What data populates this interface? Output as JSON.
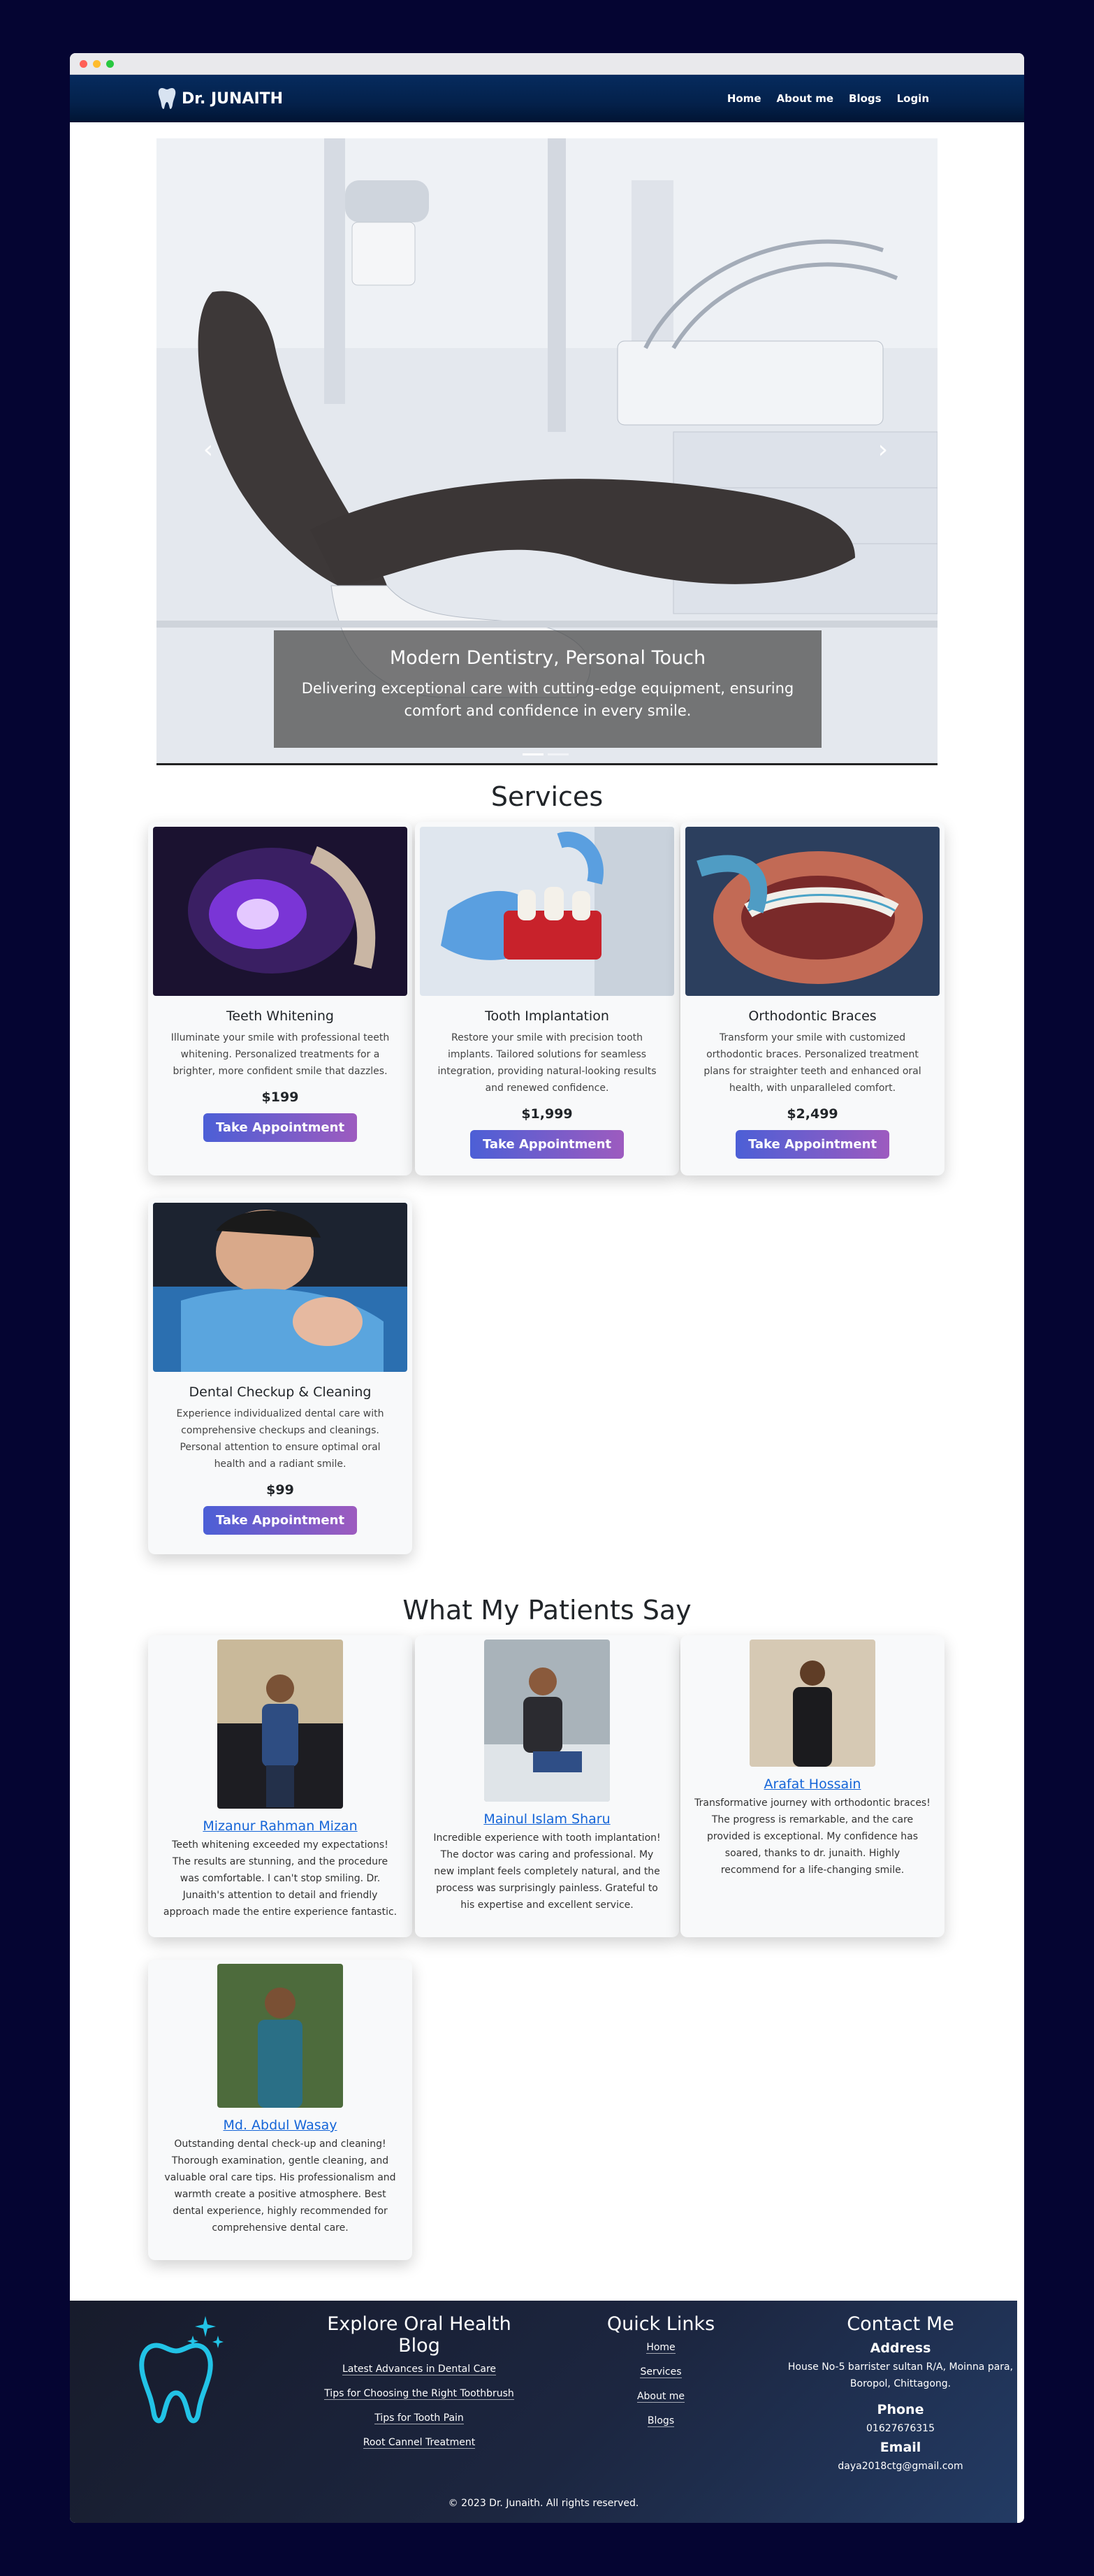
{
  "brand": {
    "name": "Dr. JUNAITH"
  },
  "nav": {
    "items": [
      "Home",
      "About me",
      "Blogs",
      "Login"
    ]
  },
  "hero": {
    "title": "Modern Dentistry, Personal Touch",
    "text": "Delivering exceptional care with cutting-edge equipment, ensuring comfort and confidence in every smile.",
    "prev_icon": "chevron-left-icon",
    "next_icon": "chevron-right-icon"
  },
  "services": {
    "title": "Services",
    "button_label": "Take Appointment",
    "items": [
      {
        "title": "Teeth Whitening",
        "desc": "Illuminate your smile with professional teeth whitening. Personalized treatments for a brighter, more confident smile that dazzles.",
        "price": "$199"
      },
      {
        "title": "Tooth Implantation",
        "desc": "Restore your smile with precision tooth implants. Tailored solutions for seamless integration, providing natural-looking results and renewed confidence.",
        "price": "$1,999"
      },
      {
        "title": "Orthodontic Braces",
        "desc": "Transform your smile with customized orthodontic braces. Personalized treatment plans for straighter teeth and enhanced oral health, with unparalleled comfort.",
        "price": "$2,499"
      },
      {
        "title": "Dental Checkup & Cleaning",
        "desc": "Experience individualized dental care with comprehensive checkups and cleanings. Personal attention to ensure optimal oral health and a radiant smile.",
        "price": "$99"
      }
    ]
  },
  "testimonials": {
    "title": "What My Patients Say",
    "items": [
      {
        "name": "Mizanur Rahman Mizan",
        "text": "Teeth whitening exceeded my expectations! The results are stunning, and the procedure was comfortable. I can't stop smiling. Dr. Junaith's attention to detail and friendly approach made the entire experience fantastic."
      },
      {
        "name": "Mainul Islam Sharu",
        "text": "Incredible experience with tooth implantation! The doctor was caring and professional. My new implant feels completely natural, and the process was surprisingly painless. Grateful to his expertise and excellent service."
      },
      {
        "name": "Arafat Hossain",
        "text": "Transformative journey with orthodontic braces! The progress is remarkable, and the care provided is exceptional. My confidence has soared, thanks to dr. junaith. Highly recommend for a life-changing smile."
      },
      {
        "name": "Md. Abdul Wasay",
        "text": "Outstanding dental check-up and cleaning! Thorough examination, gentle cleaning, and valuable oral care tips. His professionalism and warmth create a positive atmosphere. Best dental experience, highly recommended for comprehensive dental care."
      }
    ]
  },
  "footer": {
    "logo_icon": "tooth-sparkle-icon",
    "blog": {
      "title": "Explore Oral Health Blog",
      "links": [
        "Latest Advances in Dental Care",
        "Tips for Choosing the Right Toothbrush",
        "Tips for Tooth Pain",
        "Root Cannel Treatment"
      ]
    },
    "quick": {
      "title": "Quick Links",
      "links": [
        "Home",
        "Services",
        "About me",
        "Blogs"
      ]
    },
    "contact": {
      "title": "Contact Me",
      "address_label": "Address",
      "address": "House No-5 barrister sultan R/A, Moinna para, Boropol, Chittagong.",
      "phone_label": "Phone",
      "phone": "01627676315",
      "email_label": "Email",
      "email": "daya2018ctg@gmail.com"
    },
    "copyright": "© 2023 Dr. Junaith. All rights reserved."
  },
  "colors": {
    "page_bg": "#050532",
    "navbar": "#04214b",
    "button_start": "#4c5fd6",
    "button_end": "#9d5bbf",
    "link": "#1565d8",
    "footer_bg": "#1c2640",
    "logo_teal": "#22c3e6"
  }
}
